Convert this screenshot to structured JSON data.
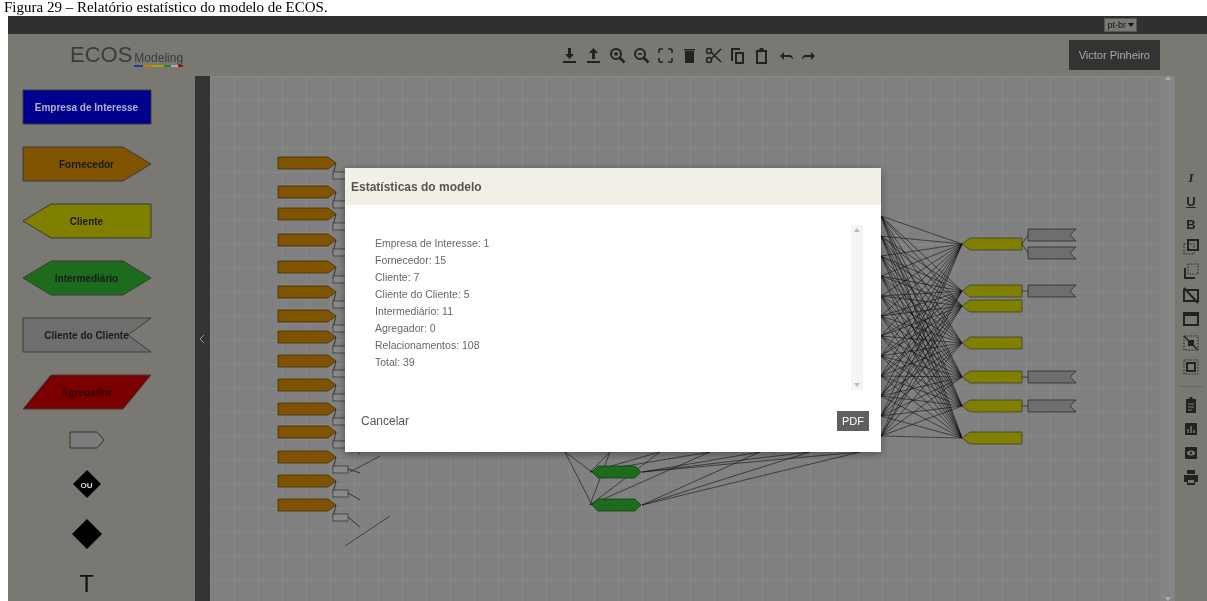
{
  "caption": "Figura 29 – Relatório estatístico do modelo de ECOS.",
  "language_select": {
    "value": "pt-br"
  },
  "logo": {
    "title": "ECOS",
    "subtitle": "Modeling"
  },
  "user_button": {
    "label": "Victor Pinheiro"
  },
  "palette": [
    {
      "kind": "empresa",
      "label": "Empresa de Interesse"
    },
    {
      "kind": "fornecedor",
      "label": "Fornecedor"
    },
    {
      "kind": "cliente",
      "label": "Cliente"
    },
    {
      "kind": "intermediario",
      "label": "Intermediário"
    },
    {
      "kind": "cliente_do_cliente",
      "label": "Cliente do Cliente"
    },
    {
      "kind": "agregador",
      "label": "Agregador"
    },
    {
      "kind": "tag"
    },
    {
      "kind": "ou",
      "label": "OU"
    },
    {
      "kind": "diamond"
    },
    {
      "kind": "text",
      "label": "T"
    }
  ],
  "format_buttons": [
    "I",
    "U",
    "B"
  ],
  "dialog": {
    "title": "Estatísticas do modelo",
    "lines": [
      "Empresa de Interesse: 1",
      "Fornecedor: 15",
      "Cliente: 7",
      "Cliente do Cliente: 5",
      "Intermediário: 11",
      "Agregador: 0",
      "Relacionamentos: 108",
      "Total: 39"
    ],
    "cancel": "Cancelar",
    "pdf": "PDF"
  }
}
